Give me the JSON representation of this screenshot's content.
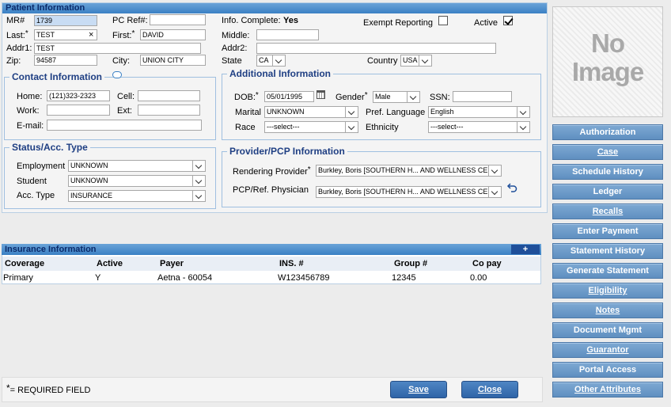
{
  "patient": {
    "title": "Patient Information",
    "mr_label": "MR#",
    "mr_value": "1739",
    "pcref_label": "PC Ref#:",
    "pcref_value": "",
    "info_complete_label": "Info. Complete:",
    "info_complete_value": "Yes",
    "exempt_label": "Exempt Reporting",
    "exempt_checked": false,
    "active_label": "Active",
    "active_checked": true,
    "last_label": "Last:",
    "last_value": "TEST",
    "clear_glyph": "×",
    "first_label": "First:",
    "first_value": "DAVID",
    "middle_label": "Middle:",
    "middle_value": "",
    "addr1_label": "Addr1:",
    "addr1_value": "TEST",
    "addr2_label": "Addr2:",
    "addr2_value": "",
    "zip_label": "Zip:",
    "zip_value": "94587",
    "city_label": "City:",
    "city_value": "UNION CITY",
    "state_label": "State",
    "state_value": "CA",
    "country_label": "Country",
    "country_value": "USA"
  },
  "contact": {
    "title": "Contact Information",
    "home_label": "Home:",
    "home_value": "(121)323-2323",
    "cell_label": "Cell:",
    "cell_value": "",
    "work_label": "Work:",
    "work_value": "",
    "ext_label": "Ext:",
    "ext_value": "",
    "email_label": "E-mail:",
    "email_value": ""
  },
  "status": {
    "title": "Status/Acc. Type",
    "employment_label": "Employment",
    "employment_value": "UNKNOWN",
    "student_label": "Student",
    "student_value": "UNKNOWN",
    "acctype_label": "Acc. Type",
    "acctype_value": "INSURANCE"
  },
  "additional": {
    "title": "Additional Information",
    "dob_label": "DOB:",
    "dob_value": "05/01/1995",
    "gender_label": "Gender",
    "gender_value": "Male",
    "ssn_label": "SSN:",
    "ssn_value": "",
    "marital_label": "Marital",
    "marital_value": "UNKNOWN",
    "preflang_label": "Pref. Language",
    "preflang_value": "English",
    "race_label": "Race",
    "race_value": "---select---",
    "ethnicity_label": "Ethnicity",
    "ethnicity_value": "---select---"
  },
  "provider": {
    "title": "Provider/PCP Information",
    "rendering_label": "Rendering Provider",
    "rendering_value": "Burkley, Boris [SOUTHERN H... AND WELLNESS CENT",
    "pcp_label": "PCP/Ref. Physician",
    "pcp_value": "Burkley, Boris [SOUTHERN H... AND WELLNESS CENT"
  },
  "image": {
    "placeholder_line1": "No",
    "placeholder_line2": "Image"
  },
  "sidebar": {
    "buttons": [
      "Authorization",
      "Case",
      "Schedule History",
      "Ledger",
      "Recalls",
      "Enter Payment",
      "Statement History",
      "Generate Statement",
      "Eligibility",
      "Notes",
      "Document Mgmt",
      "Guarantor",
      "Portal Access",
      "Other Attributes"
    ]
  },
  "insurance": {
    "title": "Insurance Information",
    "add_label": "+",
    "columns": [
      "Coverage",
      "Active",
      "Payer",
      "INS. #",
      "Group #",
      "Co pay"
    ],
    "rows": [
      [
        "Primary",
        "Y",
        "Aetna - 60054",
        "W123456789",
        "12345",
        "0.00"
      ]
    ]
  },
  "footer": {
    "required_star": "*",
    "required_note": "= REQUIRED FIELD",
    "save_label": "Save",
    "close_label": "Close"
  },
  "colors": {
    "header_blue": "#3a80c4",
    "section_title": "#1f3f83",
    "side_button": "#6b98c6",
    "readonly_field": "#c8dcf3"
  }
}
